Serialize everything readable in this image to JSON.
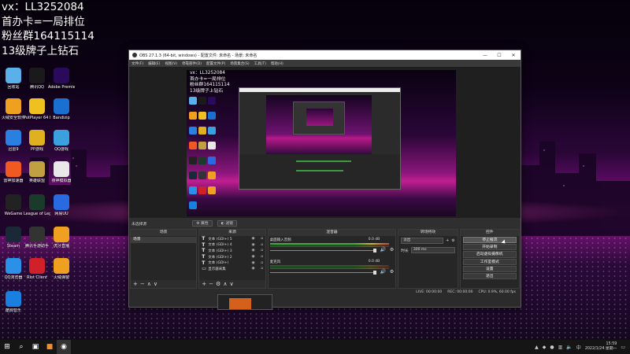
{
  "overlay": {
    "lines": [
      "vx：LL3252084",
      "首办卡=一局排位",
      "粉丝群164115114",
      "13级牌子上钻石"
    ]
  },
  "desktop_icons": [
    {
      "label": "回收站",
      "icon": "recycle-bin-icon",
      "color": "#5ab0e8"
    },
    {
      "label": "腾讯QQ",
      "icon": "qq-icon",
      "color": "#1a1a1a"
    },
    {
      "label": "Adobe Premie...",
      "icon": "premiere-icon",
      "color": "#2a0a5a"
    },
    {
      "label": "火绒安全软件",
      "icon": "huorong-icon",
      "color": "#f0a020"
    },
    {
      "label": "PotPlayer 64 bit",
      "icon": "potplayer-icon",
      "color": "#f0c020"
    },
    {
      "label": "Bandizip",
      "icon": "bandizip-icon",
      "color": "#1a70d0"
    },
    {
      "label": "迅雷9",
      "icon": "xunlei-icon",
      "color": "#2a80e0"
    },
    {
      "label": "PP游戏",
      "icon": "pp-game-icon",
      "color": "#e0b020"
    },
    {
      "label": "QQ游戏",
      "icon": "qq-game-icon",
      "color": "#3aa0e0"
    },
    {
      "label": "雷神加速器",
      "icon": "leishen-icon",
      "color": "#f05a20"
    },
    {
      "label": "英雄联盟",
      "icon": "lol-icon",
      "color": "#c0a040"
    },
    {
      "label": "夜神模拟器",
      "icon": "nox-icon",
      "color": "#e8e8e8"
    },
    {
      "label": "WeGame",
      "icon": "wegame-icon",
      "color": "#222222"
    },
    {
      "label": "League of Legends",
      "icon": "league-icon",
      "color": "#1a3a2a"
    },
    {
      "label": "网易UU",
      "icon": "uu-icon",
      "color": "#2a6ae0"
    },
    {
      "label": "Steam",
      "icon": "steam-icon",
      "color": "#1b2838"
    },
    {
      "label": "腾讯手游助手",
      "icon": "tencent-assistant-icon",
      "color": "#333333"
    },
    {
      "label": "虎牙直播",
      "icon": "huya-icon",
      "color": "#f0a020"
    },
    {
      "label": "QQ浏览器",
      "icon": "qq-browser-icon",
      "color": "#2a90e8"
    },
    {
      "label": "Riot Client",
      "icon": "riot-icon",
      "color": "#d0202a"
    },
    {
      "label": "火绒弹窗",
      "icon": "popup-icon",
      "color": "#f0a020"
    },
    {
      "label": "酷狗音乐",
      "icon": "kugou-icon",
      "color": "#1a80e0"
    }
  ],
  "obs": {
    "title": "OBS 27.1.3 (64-bit, windows) - 配置文件: 未命名 - 场景: 未命名",
    "menu": [
      "文件(F)",
      "编辑(E)",
      "视图(V)",
      "停靠部件(D)",
      "配置文件(P)",
      "场景集合(S)",
      "工具(T)",
      "帮助(H)"
    ],
    "preview_text": [
      "vx：LL3252084",
      "首办卡=一局排位",
      "粉丝群164115114",
      "13级牌子上钻石"
    ],
    "toolbar": {
      "no_source": "未选择源",
      "properties": "属性",
      "filters": "滤镜"
    },
    "docks": {
      "scenes_title": "场景",
      "sources_title": "来源",
      "mixer_title": "混音器",
      "transitions_title": "转场特效",
      "controls_title": "控件"
    },
    "scenes": [
      "场景"
    ],
    "sources": [
      "文本 (GDI+) 5",
      "文本 (GDI+) 4",
      "文本 (GDI+) 3",
      "文本 (GDI+) 2",
      "文本 (GDI+)",
      "显示器采集"
    ],
    "mixer": [
      {
        "name": "桌面输入音频",
        "db": "0.0 dB"
      },
      {
        "name": "麦克风",
        "db": "0.0 dB"
      }
    ],
    "transitions": {
      "type": "淡出",
      "duration_label": "时长",
      "duration": "300 ms"
    },
    "controls": [
      "停止推流",
      "开始录制",
      "启动虚拟摄像机",
      "工作室模式",
      "设置",
      "退出"
    ],
    "status": [
      "LIVE: 00:00:00",
      "REC: 00:00:00",
      "CPU: 0.9%, 60.00 fps"
    ]
  },
  "taskbar": {
    "time": "15:59",
    "date": "2022/1/24 星期一"
  }
}
